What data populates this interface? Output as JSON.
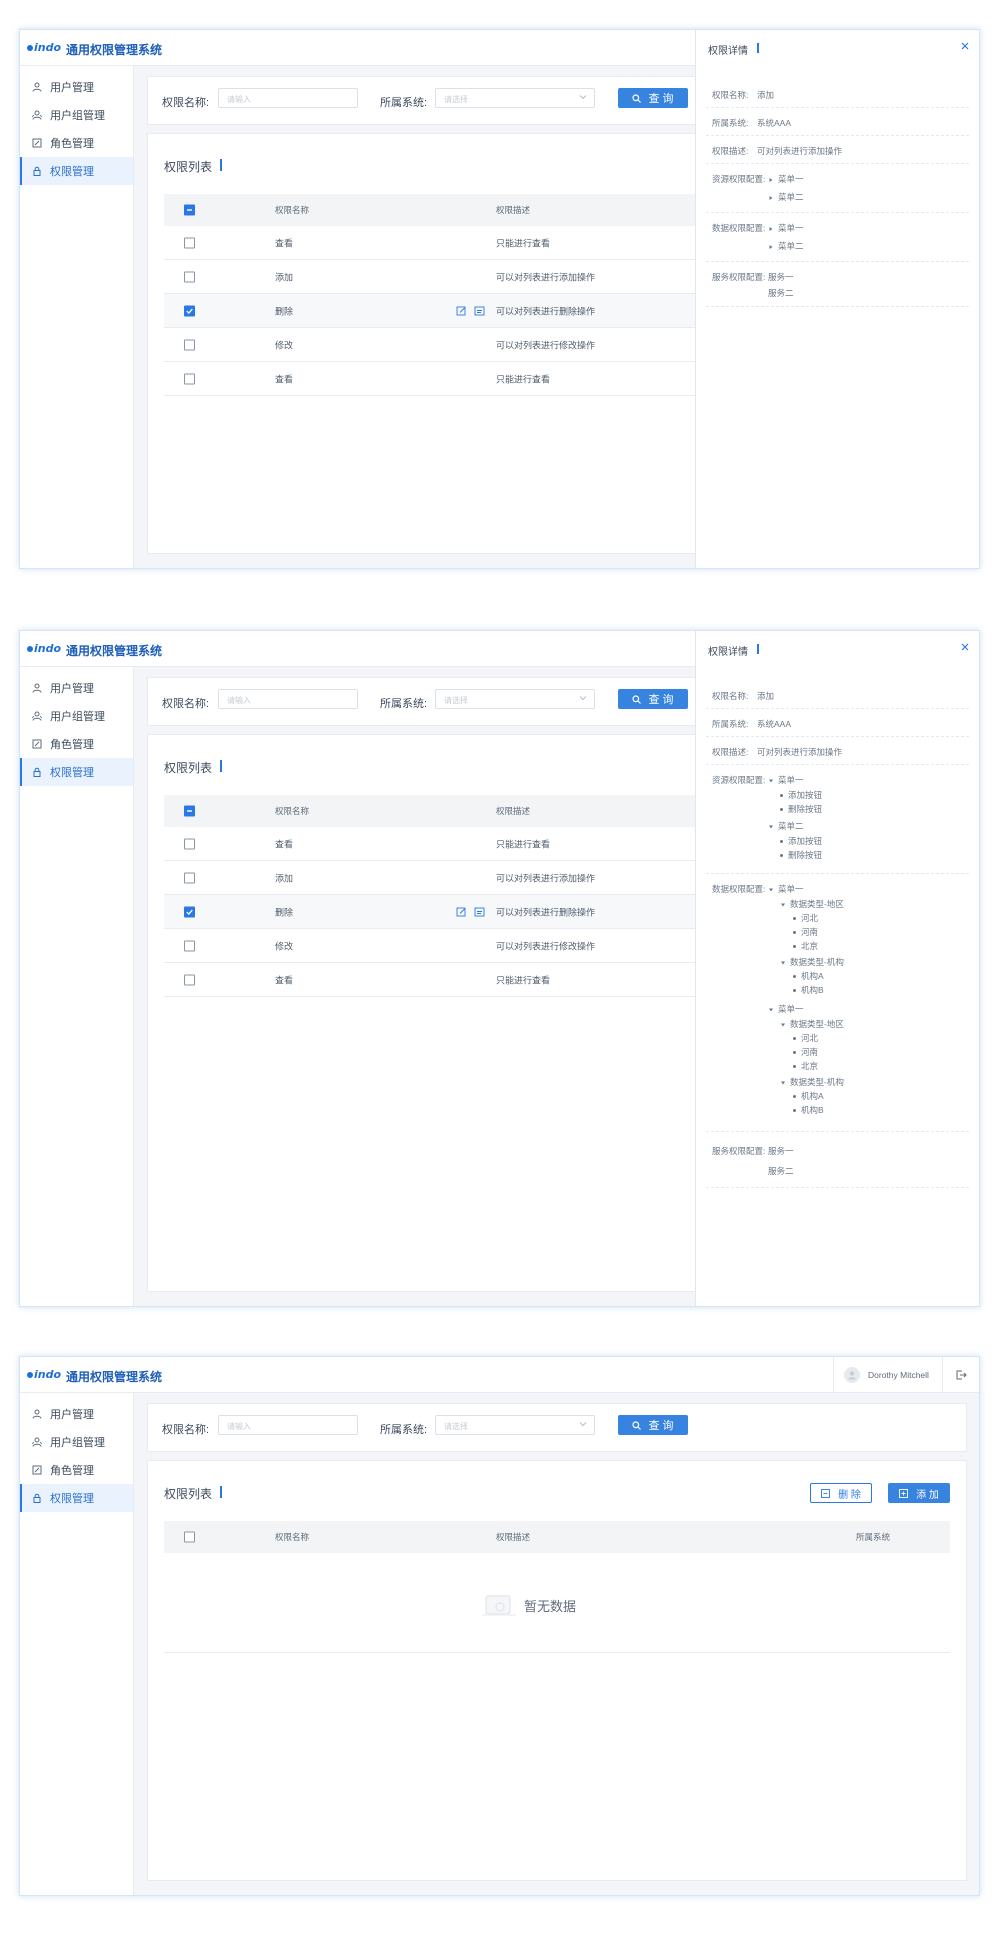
{
  "app": {
    "logo": "indo",
    "title": "通用权限管理系统"
  },
  "sidebar": {
    "items": [
      {
        "label": "用户管理",
        "icon": "user-icon"
      },
      {
        "label": "用户组管理",
        "icon": "user-group-icon"
      },
      {
        "label": "角色管理",
        "icon": "role-icon"
      },
      {
        "label": "权限管理",
        "icon": "lock-icon",
        "active": true
      }
    ]
  },
  "search": {
    "name_label": "权限名称:",
    "name_placeholder": "请输入",
    "system_label": "所属系统:",
    "system_placeholder": "请选择",
    "query_label": "查 询"
  },
  "list": {
    "title": "权限列表",
    "columns": [
      "权限名称",
      "权限描述",
      "所属系统"
    ],
    "rows": [
      {
        "name": "查看",
        "desc": "只能进行查看",
        "checked": false
      },
      {
        "name": "添加",
        "desc": "可以对列表进行添加操作",
        "checked": false
      },
      {
        "name": "删除",
        "desc": "可以对列表进行删除操作",
        "checked": true
      },
      {
        "name": "修改",
        "desc": "可以对列表进行修改操作",
        "checked": false
      },
      {
        "name": "查看",
        "desc": "只能进行查看",
        "checked": false
      }
    ],
    "delete_label": "删 除",
    "add_label": "添 加",
    "empty_text": "暂无数据"
  },
  "detail": {
    "title": "权限详情",
    "name_label": "权限名称:",
    "name_value": "添加",
    "system_label": "所属系统:",
    "system_value": "系统AAA",
    "desc_label": "权限描述:",
    "desc_value": "可对列表进行添加操作",
    "resource_label": "资源权限配置:",
    "data_label": "数据权限配置:",
    "service_label": "服务权限配置:",
    "menus_collapsed": [
      "菜单一",
      "菜单二"
    ],
    "services": [
      "服务一",
      "服务二"
    ],
    "resource_tree": [
      {
        "label": "菜单一",
        "children": [
          "添加按钮",
          "删除按钮"
        ]
      },
      {
        "label": "菜单二",
        "children": [
          "添加按钮",
          "删除按钮"
        ]
      }
    ],
    "data_tree": [
      {
        "label": "菜单一",
        "children": [
          {
            "label": "数据类型-地区",
            "children": [
              "河北",
              "河南",
              "北京"
            ]
          },
          {
            "label": "数据类型-机构",
            "children": [
              "机构A",
              "机构B"
            ]
          }
        ]
      },
      {
        "label": "菜单一",
        "children": [
          {
            "label": "数据类型-地区",
            "children": [
              "河北",
              "河南",
              "北京"
            ]
          },
          {
            "label": "数据类型-机构",
            "children": [
              "机构A",
              "机构B"
            ]
          }
        ]
      }
    ]
  },
  "user": {
    "name": "Dorothy Mitchell"
  },
  "colors": {
    "primary": "#3683e0",
    "accent": "#2b78e4",
    "title_blue": "#1f5fb8"
  }
}
